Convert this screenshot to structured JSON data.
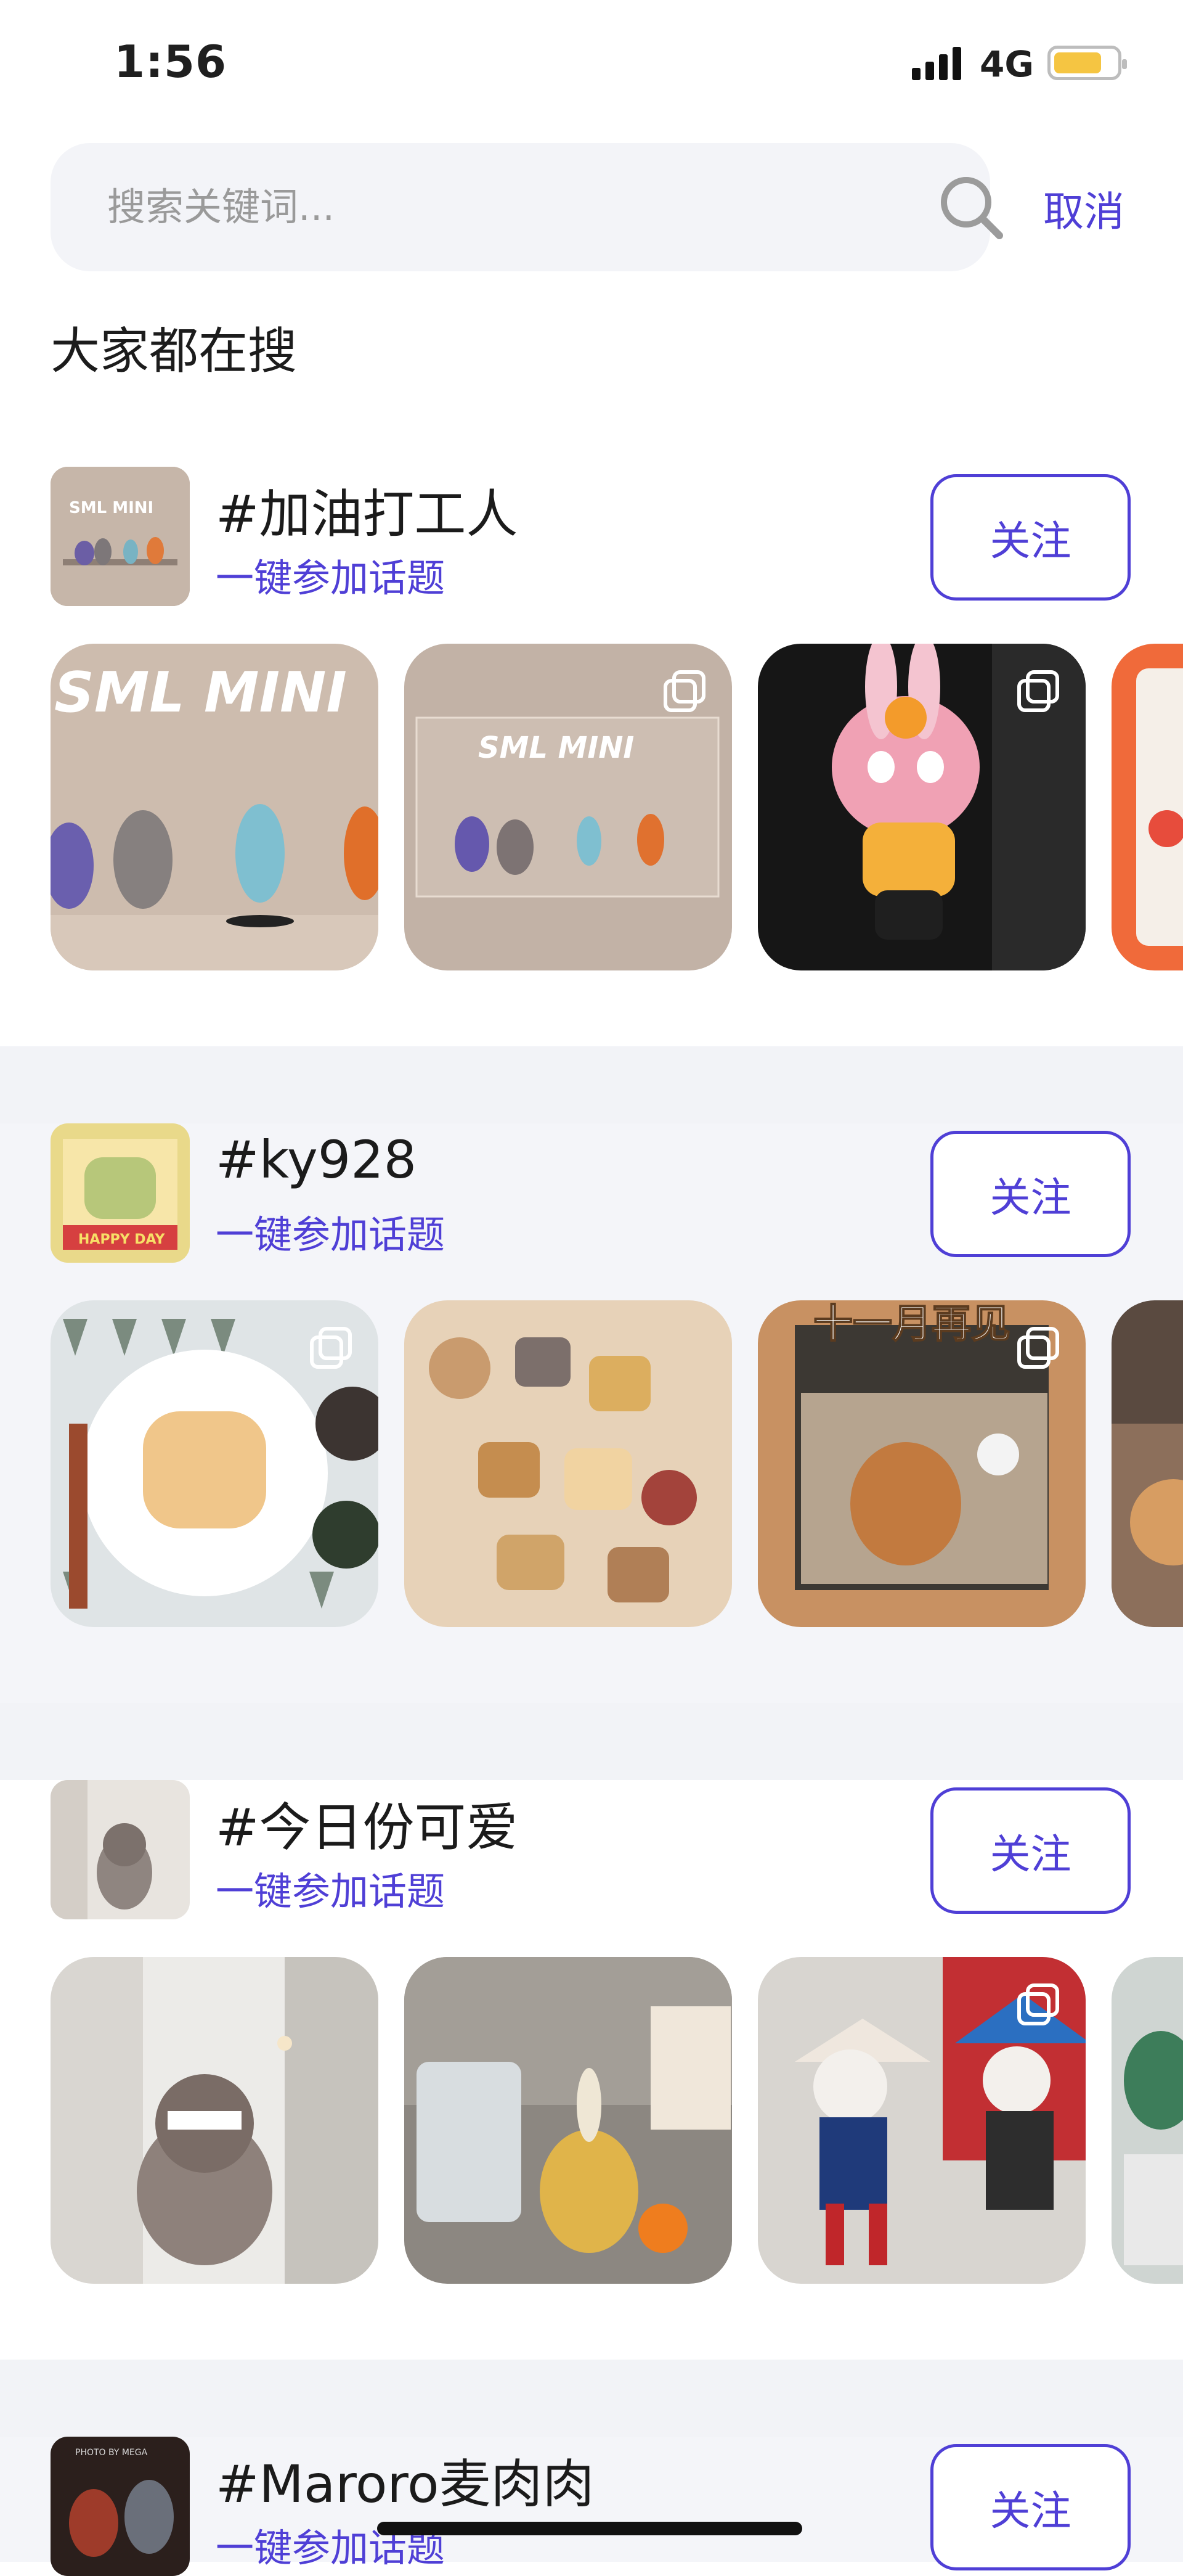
{
  "status_bar": {
    "time": "1:56",
    "network": "4G"
  },
  "search": {
    "placeholder": "搜索关键词...",
    "cancel_label": "取消"
  },
  "section_title": "大家都在搜",
  "topics": [
    {
      "name": "#加油打工人",
      "join_label": "一键参加话题",
      "follow_label": "关注",
      "avatar_text": "SML MINI",
      "thumb_texts": [
        "SML MINI",
        "SML MINI"
      ]
    },
    {
      "name": "#ky928",
      "join_label": "一键参加话题",
      "follow_label": "关注",
      "avatar_text": "HAPPY DAY",
      "thumb_texts": [
        "十一月再见"
      ]
    },
    {
      "name": "#今日份可爱",
      "join_label": "一键参加话题",
      "follow_label": "关注"
    },
    {
      "name": "#Maroro麦肉肉",
      "join_label": "一键参加话题",
      "follow_label": "关注",
      "avatar_text": "PHOTO BY MEGA"
    }
  ],
  "colors": {
    "accent": "#4f3fd6",
    "section_bg": "#f2f3f7"
  },
  "icons": [
    "search-icon",
    "multi-image-icon",
    "signal-icon",
    "battery-icon"
  ]
}
